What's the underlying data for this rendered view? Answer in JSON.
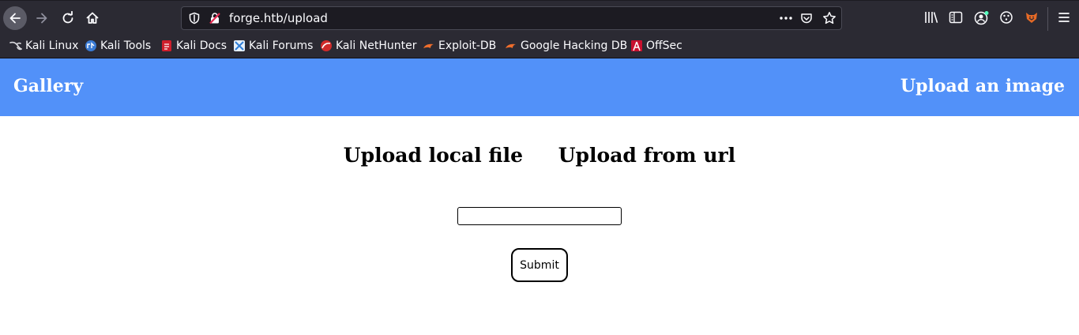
{
  "browser": {
    "url": "forge.htb/upload",
    "icons": {
      "back": "arrow-left-icon",
      "forward": "arrow-right-icon",
      "reload": "reload-icon",
      "home": "home-icon",
      "tracking": "shield-icon",
      "insecure": "insecure-lock-icon",
      "page_actions": "more-dots-icon",
      "pocket": "pocket-icon",
      "bookmark": "star-icon",
      "library": "library-icon",
      "sidebar": "sidebar-icon",
      "account": "account-icon",
      "extensions": "extensions-icon",
      "extension_fox": "fox-extension-icon",
      "menu": "hamburger-menu-icon"
    },
    "bookmarks": [
      {
        "label": "Kali Linux",
        "icon": "kali-dragon-icon"
      },
      {
        "label": "Kali Tools",
        "icon": "kali-tools-icon"
      },
      {
        "label": "Kali Docs",
        "icon": "kali-docs-icon"
      },
      {
        "label": "Kali Forums",
        "icon": "kali-forums-icon"
      },
      {
        "label": "Kali NetHunter",
        "icon": "nethunter-icon"
      },
      {
        "label": "Exploit-DB",
        "icon": "exploit-db-icon"
      },
      {
        "label": "Google Hacking DB",
        "icon": "ghdb-icon"
      },
      {
        "label": "OffSec",
        "icon": "offsec-icon"
      }
    ]
  },
  "site": {
    "brand": "Gallery",
    "nav_right": "Upload an image",
    "tabs": [
      "Upload local file",
      "Upload from url"
    ],
    "url_field": {
      "value": "",
      "placeholder": ""
    },
    "submit_label": "Submit"
  },
  "colors": {
    "nav_bg": "#5291f9",
    "chrome_bg": "#2b2a33",
    "urlbar_bg": "#1c1b22"
  }
}
